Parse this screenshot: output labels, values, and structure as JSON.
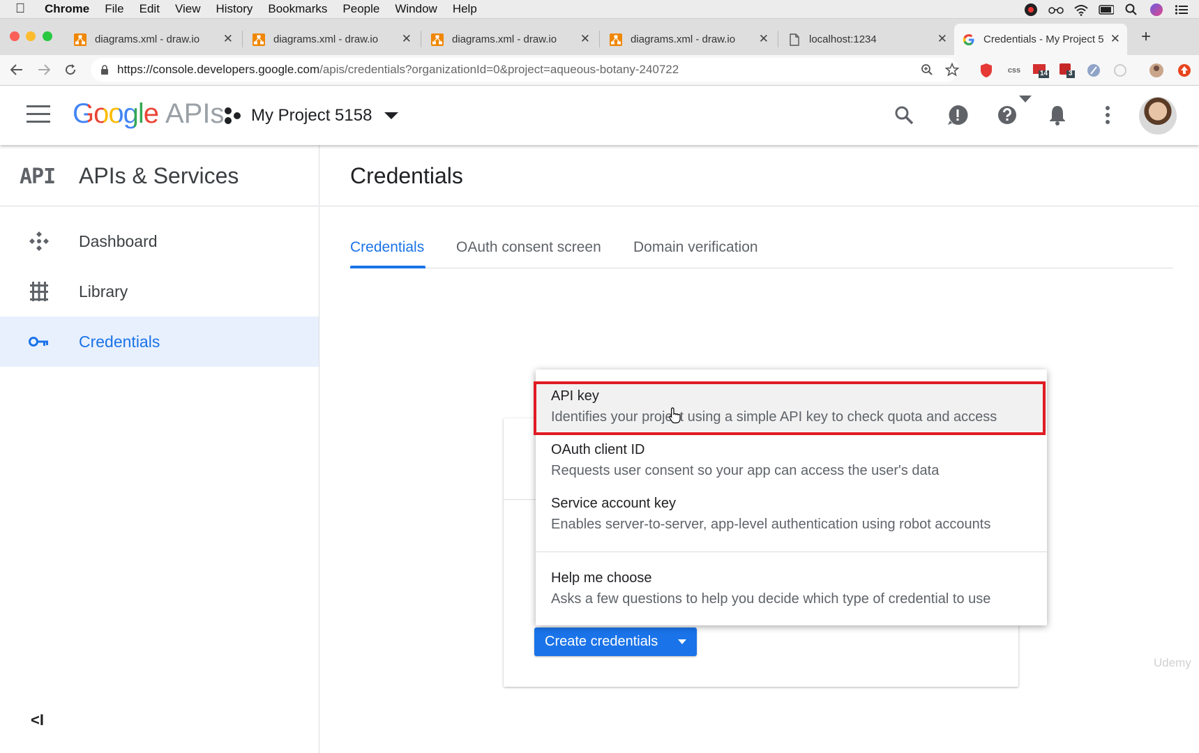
{
  "menubar": {
    "app": "Chrome",
    "items": [
      "File",
      "Edit",
      "View",
      "History",
      "Bookmarks",
      "People",
      "Window",
      "Help"
    ]
  },
  "tabs": [
    {
      "title": "diagrams.xml - draw.io",
      "favicon": "drawio-icon"
    },
    {
      "title": "diagrams.xml - draw.io",
      "favicon": "drawio-icon"
    },
    {
      "title": "diagrams.xml - draw.io",
      "favicon": "drawio-icon"
    },
    {
      "title": "diagrams.xml - draw.io",
      "favicon": "drawio-icon"
    },
    {
      "title": "localhost:1234",
      "favicon": "document-icon"
    },
    {
      "title": "Credentials - My Project 5",
      "favicon": "google-icon",
      "active": true
    }
  ],
  "address": {
    "host": "https://console.developers.google.com",
    "path": "/apis/credentials?organizationId=0&project=aqueous-botany-240722"
  },
  "extensions": {
    "css_label": "css",
    "badge_1": "14",
    "badge_2": "3"
  },
  "header": {
    "logo_google": "Google",
    "logo_apis": "APIs",
    "project_name": "My Project 5158"
  },
  "sidebar": {
    "badge": "API",
    "title": "APIs & Services",
    "items": [
      {
        "label": "Dashboard",
        "icon": "dashboard-icon"
      },
      {
        "label": "Library",
        "icon": "library-icon"
      },
      {
        "label": "Credentials",
        "icon": "key-icon",
        "selected": true
      }
    ],
    "collapse": "<I"
  },
  "main": {
    "title": "Credentials",
    "tabs": [
      "Credentials",
      "OAuth consent screen",
      "Domain verification"
    ]
  },
  "menu": {
    "items": [
      {
        "title": "API key",
        "desc": "Identifies your project using a simple API key to check quota and access"
      },
      {
        "title": "OAuth client ID",
        "desc": "Requests user consent so your app can access the user's data"
      },
      {
        "title": "Service account key",
        "desc": "Enables server-to-server, app-level authentication using robot accounts"
      },
      {
        "title": "Help me choose",
        "desc": "Asks a few questions to help you decide which type of credential to use"
      }
    ]
  },
  "create_button": "Create credentials",
  "watermark": "Udemy",
  "colors": {
    "accent": "#1a73e8",
    "highlight": "#e01b24",
    "selected_bg": "#e8f0fe"
  }
}
